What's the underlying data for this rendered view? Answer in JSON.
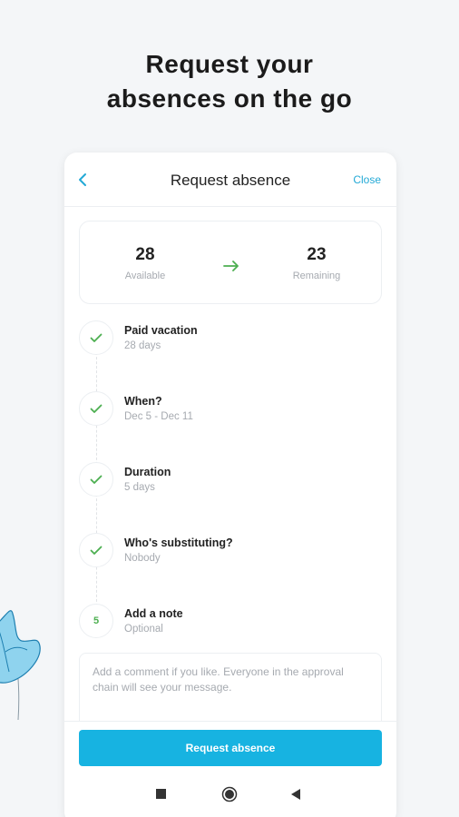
{
  "headline": {
    "line1": "Request your",
    "line2": "absences on the go"
  },
  "appbar": {
    "title": "Request absence",
    "close_label": "Close"
  },
  "summary": {
    "available_value": "28",
    "available_label": "Available",
    "remaining_value": "23",
    "remaining_label": "Remaining"
  },
  "steps": [
    {
      "title": "Paid vacation",
      "subtitle": "28 days",
      "state": "done"
    },
    {
      "title": "When?",
      "subtitle": "Dec 5 - Dec 11",
      "state": "done"
    },
    {
      "title": "Duration",
      "subtitle": "5 days",
      "state": "done"
    },
    {
      "title": "Who's substituting?",
      "subtitle": "Nobody",
      "state": "done"
    },
    {
      "title": "Add a note",
      "subtitle": "Optional",
      "state": "current",
      "number": "5"
    }
  ],
  "note": {
    "placeholder": "Add a comment if you like. Everyone in the approval chain will see your message."
  },
  "cta": {
    "label": "Request absence"
  },
  "colors": {
    "accent": "#17b3e1",
    "link": "#23a9d6",
    "check": "#4caf50",
    "background": "#f4f6f8"
  },
  "icons": {
    "back": "chevron-left-icon",
    "arrow": "arrow-right-icon",
    "check": "check-icon",
    "nav_recent": "square-icon",
    "nav_home": "circle-icon",
    "nav_back": "triangle-back-icon"
  }
}
